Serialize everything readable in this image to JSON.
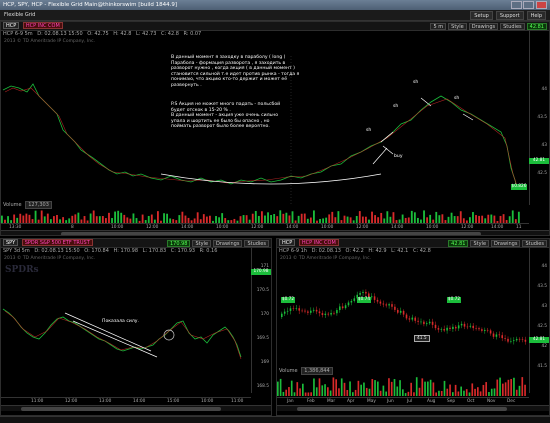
{
  "window": {
    "title": "HCP, SPY, HCP - Flexible Grid Main@thinkorswim [build 1844.9]"
  },
  "menubar": {
    "items": [
      "Flexible Grid"
    ],
    "right": [
      "Setup",
      "Support",
      "Help"
    ]
  },
  "top_panel": {
    "symbol": "HCP",
    "description": "HCP INC COM",
    "timeframe": "5 m",
    "style_label": "Style",
    "drawings_label": "Drawings",
    "studies_label": "Studies",
    "price": "42.81",
    "quote_row": [
      "HCP 6-9 5m",
      "D: 02.08.13 15:50",
      "O: 42.75",
      "H: 42.8",
      "L: 42.73",
      "C: 42.8",
      "R: 0.07"
    ],
    "copyright": "2013 © TD Ameritrade IP Company, Inc.",
    "annotation_main": [
      "В данный момент я заходку в параболу ( long )",
      "Парабола - формация разворота , я заходить в",
      "разворот нужно , когда акция ( в данный момент )",
      "становится сильной т.е идет против рынка - тогда я",
      "понимаю, что акцию кто-то держит и может её",
      "развернуть ."
    ],
    "annotation_ps": [
      "P.S   Акция не может  много падать - польсбой",
      "будет отскок в 15-20 % .",
      "В данный момент - акция уже очень сильно",
      "упала и шортить ее было бы опасно , но",
      "поймать разворот было более вероятно."
    ],
    "labels": {
      "sh1": "sh",
      "sh2": "sh",
      "sh3": "sh",
      "sh4": "sh",
      "buy": "buy"
    },
    "y_ticks": [
      "44",
      "43.5",
      "43",
      "42.5"
    ],
    "x_ticks": [
      "13:30",
      "8",
      "10:00",
      "12:00",
      "14:00",
      "10:00",
      "12:00",
      "14:00",
      "10:00",
      "12:00",
      "14:00",
      "10:00",
      "12:00",
      "14:00",
      "11"
    ],
    "volume_label": "Volume",
    "volume_value": "127,303",
    "price_tags": {
      "last": "42.81",
      "marker": "$0.826"
    }
  },
  "spy_panel": {
    "symbol": "SPY",
    "description": "SPDR S&P 500 ETF TRUST",
    "price": "170.98",
    "style_label": "Style",
    "drawings_label": "Drawings",
    "studies_label": "Studies",
    "quote_row": [
      "SPY 3d 5m",
      "D: 02.08.13 15:50",
      "O: 170.84",
      "H: 170.98",
      "L: 170.83",
      "C: 170.93",
      "R: 0.16"
    ],
    "copyright": "2013 © TD Ameritrade IP Company, Inc.",
    "watermark": "SPDRs",
    "annotation": "Показала силу.",
    "y_ticks": [
      "171",
      "170.5",
      "170",
      "169.5",
      "169",
      "168.5"
    ],
    "x_ticks": [
      "11:00",
      "12:00",
      "13:00",
      "14:00",
      "15:00",
      "10:00",
      "11:00"
    ],
    "price_tags": {
      "last": "170.98"
    }
  },
  "hcp2_panel": {
    "symbol": "HCP",
    "description": "HCP INC COM",
    "price": "42.81",
    "style_label": "Style",
    "drawings_label": "Drawings",
    "studies_label": "Studies",
    "quote_row": [
      "HCP 6-9 1h",
      "D: 02.08.13",
      "O: 42.2",
      "H: 42.9",
      "L: 42.1",
      "C: 42.8"
    ],
    "copyright": "2013 © TD Ameritrade IP Company, Inc.",
    "markers": [
      "$0.72",
      "$0.74",
      "$0.72"
    ],
    "low_label": "41.5",
    "volume_label": "Volume",
    "volume_value": "1,386,844",
    "y_ticks": [
      "44",
      "43.5",
      "43",
      "42.5",
      "42",
      "41.5"
    ],
    "x_ticks": [
      "Jan",
      "Feb",
      "Mar",
      "Apr",
      "May",
      "Jun",
      "Jul",
      "Aug",
      "Sep",
      "Oct",
      "Nov",
      "Dec"
    ],
    "price_tags": {
      "last": "42.81"
    }
  },
  "colors": {
    "up": "#1bbd3b",
    "down": "#d82a2a",
    "bg": "#000000"
  }
}
